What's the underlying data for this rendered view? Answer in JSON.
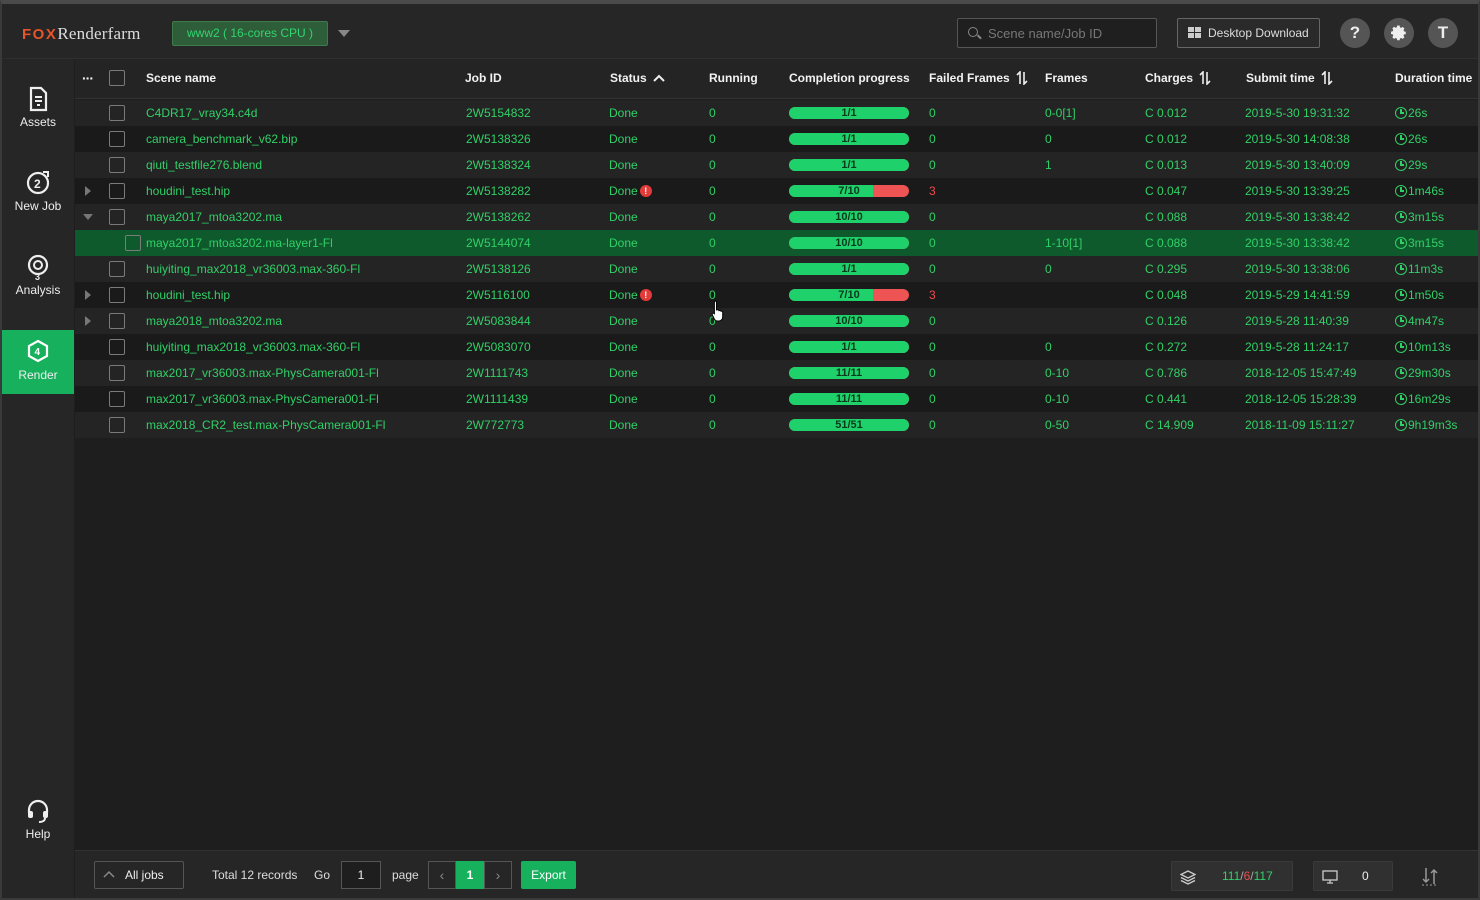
{
  "header": {
    "logo_prefix": "FOX",
    "logo_suffix": "Renderfarm",
    "region": "www2 ( 16-cores CPU )",
    "search_placeholder": "Scene name/Job ID",
    "download_label": "Desktop Download",
    "help_label": "?",
    "user_initial": "T"
  },
  "sidebar": {
    "items": [
      {
        "label": "Assets",
        "icon": "assets-icon",
        "active": false
      },
      {
        "label": "New Job",
        "icon": "new-job-icon",
        "active": false
      },
      {
        "label": "Analysis",
        "icon": "analysis-icon",
        "active": false
      },
      {
        "label": "Render",
        "icon": "render-icon",
        "active": true
      }
    ],
    "help_label": "Help"
  },
  "table": {
    "menu_glyph": "···",
    "columns": {
      "scene": "Scene name",
      "job": "Job ID",
      "status": "Status",
      "running": "Running",
      "progress": "Completion progress",
      "failed": "Failed Frames",
      "frames": "Frames",
      "charges": "Charges",
      "submit": "Submit time",
      "duration": "Duration time"
    },
    "rows": [
      {
        "scene": "C4DR17_vray34.c4d",
        "job": "2W5154832",
        "status": "Done",
        "running": "0",
        "progress": "1/1",
        "done_fraction": 1.0,
        "failed": "0",
        "frames": "0-0[1]",
        "charges": "C 0.012",
        "submit": "2019-5-30 19:31:32",
        "duration": "26s"
      },
      {
        "scene": "camera_benchmark_v62.bip",
        "job": "2W5138326",
        "status": "Done",
        "running": "0",
        "progress": "1/1",
        "done_fraction": 1.0,
        "failed": "0",
        "frames": "0",
        "charges": "C 0.012",
        "submit": "2019-5-30 14:08:38",
        "duration": "26s"
      },
      {
        "scene": "qiuti_testfile276.blend",
        "job": "2W5138324",
        "status": "Done",
        "running": "0",
        "progress": "1/1",
        "done_fraction": 1.0,
        "failed": "0",
        "frames": "1",
        "charges": "C 0.013",
        "submit": "2019-5-30 13:40:09",
        "duration": "29s"
      },
      {
        "scene": "houdini_test.hip",
        "job": "2W5138282",
        "status": "Done",
        "error": true,
        "expander": "right",
        "running": "0",
        "progress": "7/10",
        "done_fraction": 0.7,
        "failed": "3",
        "frames": "",
        "charges": "C 0.047",
        "submit": "2019-5-30 13:39:25",
        "duration": "1m46s"
      },
      {
        "scene": "maya2017_mtoa3202.ma",
        "job": "2W5138262",
        "status": "Done",
        "expander": "down",
        "running": "0",
        "progress": "10/10",
        "done_fraction": 1.0,
        "failed": "0",
        "frames": "",
        "charges": "C 0.088",
        "submit": "2019-5-30 13:38:42",
        "duration": "3m15s"
      },
      {
        "scene": "maya2017_mtoa3202.ma-layer1-Fl",
        "job": "2W5144074",
        "status": "Done",
        "child": true,
        "selected": true,
        "running": "0",
        "progress": "10/10",
        "done_fraction": 1.0,
        "failed": "0",
        "frames": "1-10[1]",
        "charges": "C 0.088",
        "submit": "2019-5-30 13:38:42",
        "duration": "3m15s"
      },
      {
        "scene": "huiyiting_max2018_vr36003.max-360-Fl",
        "job": "2W5138126",
        "status": "Done",
        "running": "0",
        "progress": "1/1",
        "done_fraction": 1.0,
        "failed": "0",
        "frames": "0",
        "charges": "C 0.295",
        "submit": "2019-5-30 13:38:06",
        "duration": "11m3s"
      },
      {
        "scene": "houdini_test.hip",
        "job": "2W5116100",
        "status": "Done",
        "error": true,
        "expander": "right",
        "running": "0",
        "progress": "7/10",
        "done_fraction": 0.7,
        "failed": "3",
        "frames": "",
        "charges": "C 0.048",
        "submit": "2019-5-29 14:41:59",
        "duration": "1m50s"
      },
      {
        "scene": "maya2018_mtoa3202.ma",
        "job": "2W5083844",
        "status": "Done",
        "expander": "right",
        "running": "0",
        "progress": "10/10",
        "done_fraction": 1.0,
        "failed": "0",
        "frames": "",
        "charges": "C 0.126",
        "submit": "2019-5-28 11:40:39",
        "duration": "4m47s"
      },
      {
        "scene": "huiyiting_max2018_vr36003.max-360-Fl",
        "job": "2W5083070",
        "status": "Done",
        "running": "0",
        "progress": "1/1",
        "done_fraction": 1.0,
        "failed": "0",
        "frames": "0",
        "charges": "C 0.272",
        "submit": "2019-5-28 11:24:17",
        "duration": "10m13s"
      },
      {
        "scene": "max2017_vr36003.max-PhysCamera001-Fl",
        "job": "2W1111743",
        "status": "Done",
        "running": "0",
        "progress": "11/11",
        "done_fraction": 1.0,
        "failed": "0",
        "frames": "0-10",
        "charges": "C 0.786",
        "submit": "2018-12-05 15:47:49",
        "duration": "29m30s"
      },
      {
        "scene": "max2017_vr36003.max-PhysCamera001-Fl",
        "job": "2W1111439",
        "status": "Done",
        "running": "0",
        "progress": "11/11",
        "done_fraction": 1.0,
        "failed": "0",
        "frames": "0-10",
        "charges": "C 0.441",
        "submit": "2018-12-05 15:28:39",
        "duration": "16m29s"
      },
      {
        "scene": "max2018_CR2_test.max-PhysCamera001-Fl",
        "job": "2W772773",
        "status": "Done",
        "running": "0",
        "progress": "51/51",
        "done_fraction": 1.0,
        "failed": "0",
        "frames": "0-50",
        "charges": "C 14.909",
        "submit": "2018-11-09 15:11:27",
        "duration": "9h19m3s"
      }
    ]
  },
  "footer": {
    "all_jobs": "All jobs",
    "total": "Total 12 records",
    "go": "Go",
    "page_value": "1",
    "page_label": "page",
    "current_page": "1",
    "prev": "‹",
    "next": "›",
    "export": "Export",
    "stat_a": "111",
    "stat_sep1": "/",
    "stat_b": "6",
    "stat_sep2": "/",
    "stat_c": "117",
    "machines": "0"
  },
  "colors": {
    "accent": "#17b15e",
    "text_green": "#31d067",
    "error_red": "#ef4b4b",
    "logo_orange": "#e8542b"
  }
}
